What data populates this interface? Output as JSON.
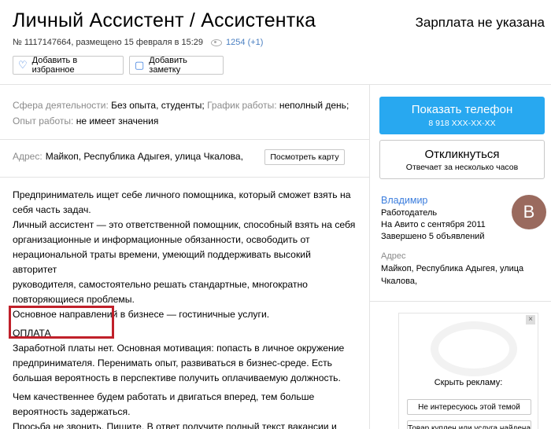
{
  "header": {
    "title": "Личный Ассистент / Ассистентка",
    "salary": "Зарплата не указана",
    "meta_text": "№ 1117147664, размещено 15 февраля в 15:29",
    "views": "1254 (+1)",
    "eye_icon": "eye-icon"
  },
  "actions": {
    "favorite_label": "Добавить в избранное",
    "favorite_icon": "heart-icon",
    "note_label": "Добавить заметку",
    "note_icon": "note-icon"
  },
  "attributes": {
    "sphere_key": "Сфера деятельности:",
    "sphere_val": "Без опыта, студенты",
    "schedule_key": "График работы:",
    "schedule_val": "неполный день",
    "experience_key": "Опыт работы:",
    "experience_val": "не имеет значения"
  },
  "address": {
    "key": "Адрес:",
    "value": "Майкоп, Республика Адыгея, улица Чкалова, ",
    "map_button": "Посмотреть карту"
  },
  "description": {
    "lines1": [
      "Предприниматель ищет себе личного помощника, который сможет взять на",
      "себя часть задач.",
      "Личный ассистент — это ответственной помощник, способный взять на себя",
      "организационные и информационные обязанности, освободить от",
      "нерациональной траты времени, умеющий поддерживать высокий авторитет",
      "руководителя, самостоятельно решать стандартные, многократно",
      "повторяющиеся проблемы.",
      "Основное направлений в бизнесе — гостиничные услуги."
    ],
    "payment_heading": "ОПЛАТА",
    "payment_line_a": "Заработной платы нет.",
    "payment_line_b": " Основная мотивация: попасть в личное окружение",
    "lines2": [
      "предпринимателя. Перенимать опыт, развиваться в бизнес-среде. Есть",
      "большая вероятность в перспективе получить оплачиваемую должность."
    ],
    "lines3": [
      "Чем качественнее будем работать и двигаться вперед, тем больше",
      "вероятность задержаться.",
      "Просьба не звонить. Пишите. В ответ получите полный текст вакансии и тест."
    ]
  },
  "sidebar": {
    "call_label": "Показать телефон",
    "call_number": "8 918 XXX-XX-XX",
    "reply_label": "Откликнуться",
    "reply_sub": "Отвечает за несколько часов",
    "seller_name": "Владимир",
    "seller_role": "Работодатель",
    "seller_since": "На Авито с сентября 2011",
    "seller_done": "Завершено 5 объявлений",
    "avatar_letter": "В",
    "addr_key": "Адрес",
    "addr_line1": "Майкоп, Республика Адыгея, улица",
    "addr_line2": "Чкалова, ",
    "ad_close": "×",
    "ad_title": "Скрыть рекламу:",
    "ad_option1": "Не интересуюсь этой темой",
    "ad_option2": "Товар куплен или услуга найдена"
  }
}
